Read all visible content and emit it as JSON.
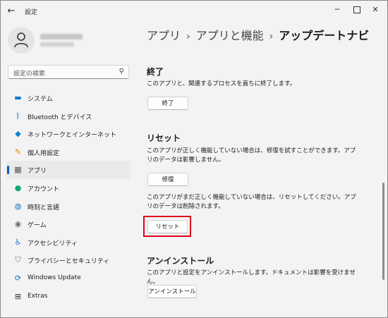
{
  "titlebar": {
    "back_icon": "arrow-left-icon",
    "title": "設定",
    "minimize": "─",
    "close": "✕"
  },
  "search": {
    "placeholder": "設定の検索"
  },
  "nav": {
    "items": [
      {
        "label": "システム",
        "icon": "monitor-icon",
        "color": "#0078d4"
      },
      {
        "label": "Bluetooth とデバイス",
        "icon": "bluetooth-icon",
        "color": "#0078d4"
      },
      {
        "label": "ネットワークとインターネット",
        "icon": "wifi-icon",
        "color": "#0a84d6"
      },
      {
        "label": "個人用設定",
        "icon": "brush-icon",
        "color": "#e5840c"
      },
      {
        "label": "アプリ",
        "icon": "apps-icon",
        "color": "#555555",
        "active": true
      },
      {
        "label": "アカウント",
        "icon": "person-icon",
        "color": "#17a67a"
      },
      {
        "label": "時刻と言語",
        "icon": "globe-clock-icon",
        "color": "#1b6fb5"
      },
      {
        "label": "ゲーム",
        "icon": "gamepad-icon",
        "color": "#6b6b6b"
      },
      {
        "label": "アクセシビリティ",
        "icon": "accessibility-icon",
        "color": "#1e6fd0"
      },
      {
        "label": "プライバシーとセキュリティ",
        "icon": "shield-icon",
        "color": "#7a7a7a"
      },
      {
        "label": "Windows Update",
        "icon": "update-icon",
        "color": "#0078d4"
      },
      {
        "label": "Extras",
        "icon": "extras-icon",
        "color": "#333333"
      }
    ]
  },
  "breadcrumb": {
    "part1": "アプリ",
    "sep": "›",
    "part2": "アプリと機能",
    "current": "アップデートナビ"
  },
  "main": {
    "terminate": {
      "title": "終了",
      "desc": "このアプリと、関連するプロセスを直ちに終了します。",
      "button": "終了"
    },
    "reset": {
      "title": "リセット",
      "repair_desc": "このアプリが正しく機能していない場合は、修復を試すことができます。アプリのデータは影響しません。",
      "repair_button": "修復",
      "reset_desc": "このアプリがまだ正しく機能していない場合は、リセットしてください。アプリのデータは削除されます。",
      "reset_button": "リセット"
    },
    "uninstall": {
      "title": "アンインストール",
      "desc": "このアプリと設定をアンインストールします。ドキュメントは影響を受けません。",
      "button": "アンインストール"
    }
  },
  "colors": {
    "accent": "#005fb8",
    "highlight": "#e0001b"
  }
}
